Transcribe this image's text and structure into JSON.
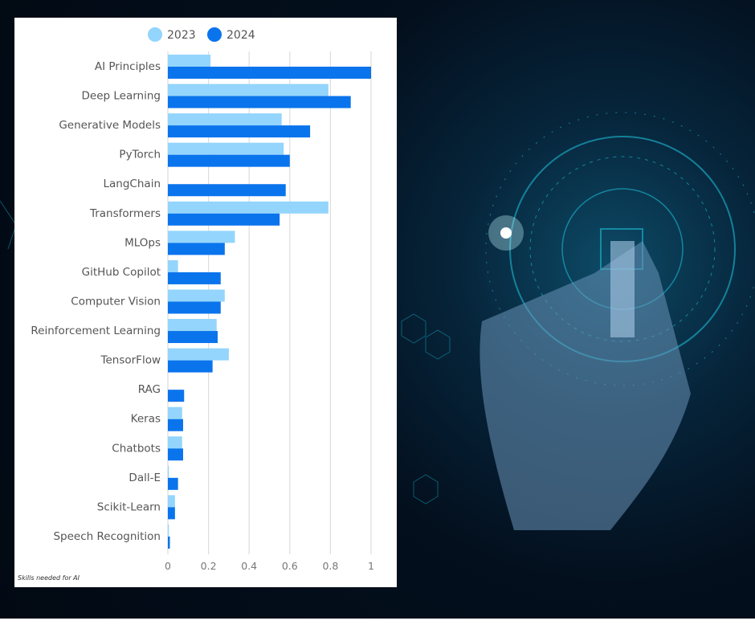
{
  "chart_data": {
    "type": "bar",
    "orientation": "horizontal",
    "categories": [
      "AI Principles",
      "Deep Learning",
      "Generative Models",
      "PyTorch",
      "LangChain",
      "Transformers",
      "MLOps",
      "GitHub Copilot",
      "Computer Vision",
      "Reinforcement Learning",
      "TensorFlow",
      "RAG",
      "Keras",
      "Chatbots",
      "Dall-E",
      "Scikit-Learn",
      "Speech Recognition"
    ],
    "series": [
      {
        "name": "2023",
        "color": "#93d5fc",
        "values": [
          0.21,
          0.79,
          0.56,
          0.57,
          0,
          0.79,
          0.33,
          0.05,
          0.28,
          0.24,
          0.3,
          0,
          0.07,
          0.07,
          0.005,
          0.035,
          0.005
        ]
      },
      {
        "name": "2024",
        "color": "#0a74ec",
        "values": [
          1.0,
          0.9,
          0.7,
          0.6,
          0.58,
          0.55,
          0.28,
          0.26,
          0.26,
          0.245,
          0.22,
          0.08,
          0.075,
          0.075,
          0.05,
          0.035,
          0.01
        ]
      }
    ],
    "xlim": [
      0,
      1
    ],
    "xticks": [
      "0",
      "0.2",
      "0.4",
      "0.6",
      "0.8",
      "1"
    ],
    "grid": true,
    "legend_position": "top-center",
    "caption": "Skills needed for AI"
  }
}
